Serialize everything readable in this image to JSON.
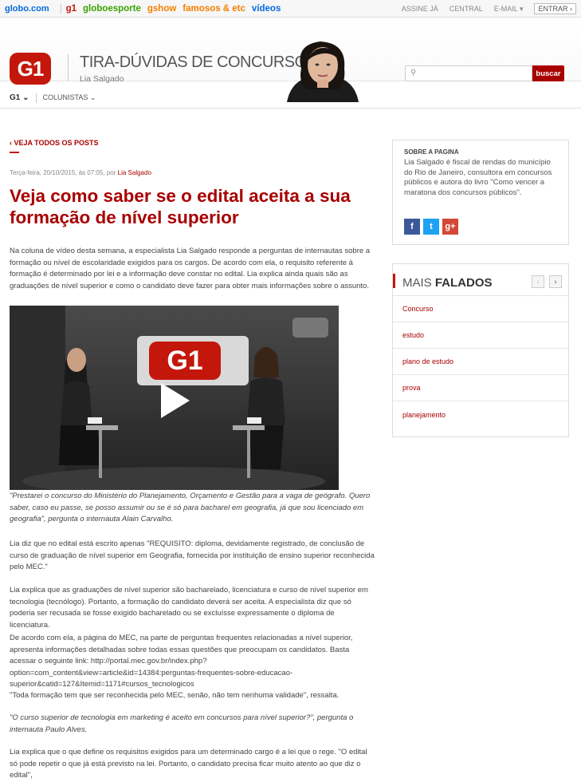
{
  "topbar": {
    "globo": "globo.com",
    "links": [
      "g1",
      "globoesporte",
      "gshow",
      "famosos & etc",
      "vídeos"
    ],
    "link_colors": [
      "#c4170c",
      "#39a300",
      "#f57e00",
      "#f57e00",
      "#0669de"
    ],
    "assine": "ASSINE JÁ",
    "central": "CENTRAL",
    "email": "E-MAIL",
    "entrar": "ENTRAR"
  },
  "header": {
    "logo": "G1",
    "title": "TIRA-DÚVIDAS DE CONCURSOS",
    "subtitle": "Lia Salgado",
    "search_button": "buscar"
  },
  "nav": {
    "g1": "G1",
    "colunistas": "COLUNISTAS"
  },
  "article": {
    "back": "VEJA TODOS OS POSTS",
    "meta_date": "Terça-feira, 20/10/2015, às 07:05, por ",
    "meta_author": "Lia Salgado",
    "title": "Veja como saber se o edital aceita a sua formação de nível superior",
    "intro": "Na coluna de vídeo desta semana, a especialista Lia Salgado responde a perguntas de internautas sobre a formação ou nível de escolaridade exigidos para os cargos. De acordo com ela, o requisito referente à formação é determinado por lei e a informação deve constar no edital. Lia explica ainda quais são as graduações de nível superior e como o candidato deve fazer para obter mais informações sobre o assunto.",
    "q1": "\"Prestarei o concurso do Ministério do Planejamento, Orçamento e Gestão para a vaga de geógrafo. Quero saber, caso eu passe, se posso assumir ou se é só para bacharel em geografia, já que sou licenciado em geografia\", pergunta o internauta Alain Carvalho.",
    "p1": "Lia diz que no edital está escrito apenas \"REQUISITO: diploma, devidamente registrado, de conclusão de curso de graduação de nível superior em Geografia, fornecida por instituição de ensino superior reconhecida pelo MEC.\"",
    "p2": "Lia explica que as graduações de nível superior são bacharelado, licenciatura e curso de nível superior em tecnologia (tecnólogo). Portanto, a formação do candidato deverá ser aceita. A especialista diz que só poderia ser recusada se fosse exigido bacharelado ou se excluísse expressamente o diploma de licenciatura.",
    "p3": "De acordo com ela, a página do MEC, na parte de perguntas frequentes relacionadas a nível superior, apresenta informações detalhadas sobre todas essas questões que preocupam os candidatos. Basta acessar o seguinte link: http://portal.mec.gov.br/index.php?option=com_content&view=article&id=14384:perguntas-frequentes-sobre-educacao-superior&catid=127&Itemid=1171#cursos_tecnologicos",
    "p4": "\"Toda formação tem que ser reconhecida pelo MEC, senão, não tem nenhuma validade\", ressalta.",
    "q2": "\"O curso superior de tecnologia em marketing é aceito em concursos para nível superior?\", pergunta o internauta Paulo Alves.",
    "p5": "Lia explica que o que define os requisitos exigidos para um determinado cargo é a lei que o rege. \"O edital só pode repetir o que já está previsto na lei. Portanto, o candidato precisa ficar muito atento ao que diz o edital\","
  },
  "sidebar": {
    "about_title": "SOBRE A PAGINA",
    "about_text": "Lia Salgado é fiscal de rendas do município do Rio de Janeiro, consultora em concursos públicos e autora do livro \"Como vencer a maratona dos concursos públicos\".",
    "social": [
      "f",
      "t",
      "g+"
    ],
    "mais_prefix": "MAIS ",
    "mais_bold": "FALADOS",
    "items": [
      "Concurso",
      "estudo",
      "plano de estudo",
      "prova",
      "planejamento"
    ]
  }
}
